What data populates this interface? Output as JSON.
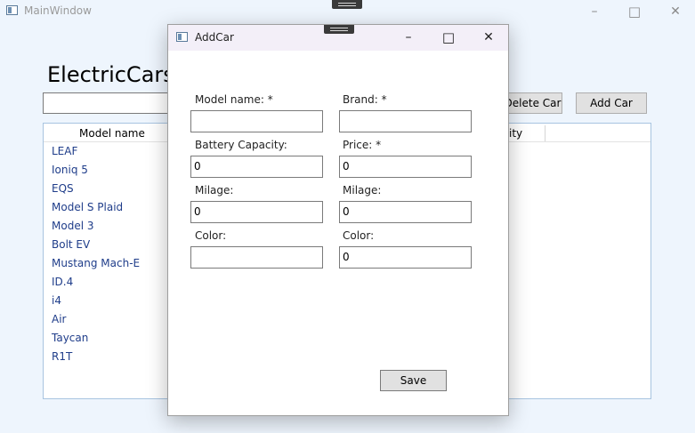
{
  "main_window": {
    "title": "MainWindow",
    "icon": "app-window-icon",
    "caption": {
      "minimize": "–",
      "maximize": "□",
      "close": "✕"
    }
  },
  "main": {
    "heading": "ElectricCars",
    "search_value": "",
    "buttons": {
      "delete": "Delete Car",
      "add": "Add Car"
    },
    "grid": {
      "col_model_name": "Model name",
      "col_capacity_partial": "ity",
      "rows": [
        "LEAF",
        "Ioniq 5",
        "EQS",
        "Model S Plaid",
        "Model 3",
        "Bolt EV",
        "Mustang Mach-E",
        "ID.4",
        "i4",
        "Air",
        "Taycan",
        "R1T"
      ]
    }
  },
  "dialog": {
    "title": "AddCar",
    "icon": "app-window-icon",
    "caption": {
      "minimize": "–",
      "maximize": "□",
      "close": "✕"
    },
    "fields": {
      "model_name": {
        "label": "Model name: *",
        "value": ""
      },
      "brand": {
        "label": "Brand: *",
        "value": ""
      },
      "battery_capacity": {
        "label": "Battery Capacity:",
        "value": "0"
      },
      "price": {
        "label": "Price: *",
        "value": "0"
      },
      "milage_left": {
        "label": "Milage:",
        "value": "0"
      },
      "milage_right": {
        "label": "Milage:",
        "value": "0"
      },
      "color_left": {
        "label": "Color:",
        "value": ""
      },
      "color_right": {
        "label": "Color:",
        "value": "0"
      }
    },
    "save_label": "Save"
  },
  "colors": {
    "background": "#eef5fd",
    "dialog_titlebar": "#f3eff8",
    "list_text": "#1f3d8a",
    "grid_border": "#a8c4e0"
  }
}
